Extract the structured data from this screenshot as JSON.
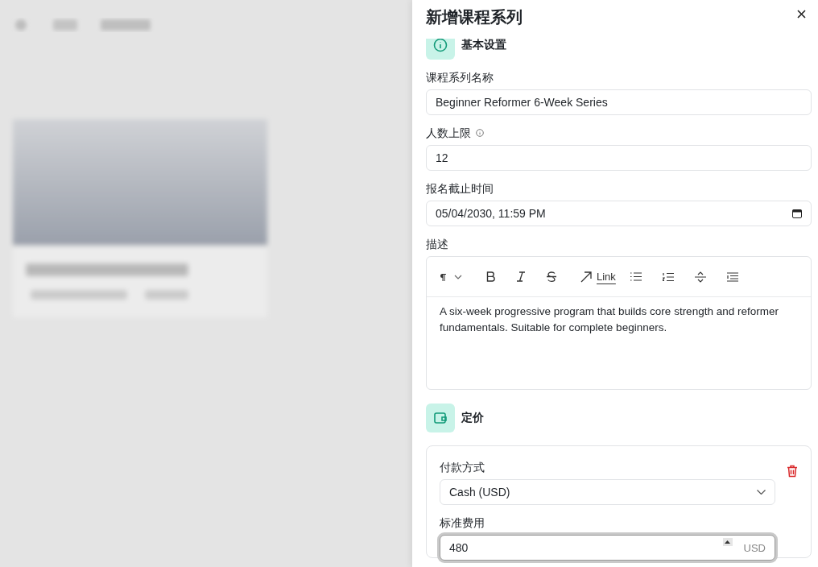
{
  "drawer": {
    "title": "新增课程系列"
  },
  "basic_section": {
    "title": "基本设置",
    "fields": [
      {
        "kind": "text",
        "label": "课程系列名称",
        "value": "Beginner Reformer 6-Week Series",
        "info": false
      },
      {
        "kind": "text",
        "label": "人数上限",
        "value": "12",
        "info": true
      },
      {
        "kind": "datetime",
        "label": "报名截止时间",
        "value": "05/04/2030, 11:59 PM",
        "info": false
      },
      {
        "kind": "editor",
        "label": "描述",
        "value": "A six-week progressive program that builds core strength and reformer fundamentals. Suitable for complete beginners.",
        "info": false,
        "link_label": "Link"
      }
    ]
  },
  "pricing_section": {
    "title": "定价",
    "options": [
      {
        "payment_label": "付款方式",
        "payment_value": "Cash (USD)",
        "fee_label": "标准费用",
        "fee_value": "480",
        "currency": "USD",
        "focused": true
      }
    ]
  }
}
